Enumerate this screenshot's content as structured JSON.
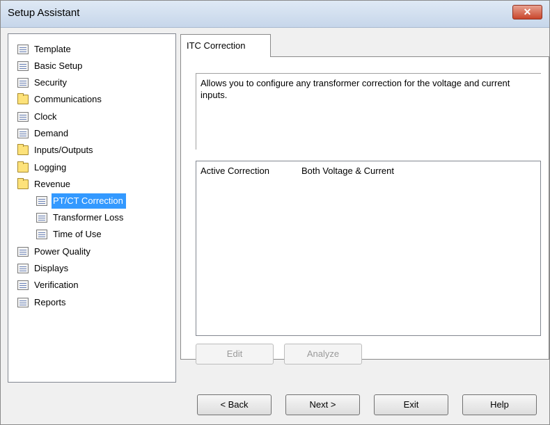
{
  "window": {
    "title": "Setup Assistant",
    "close_label": "✕"
  },
  "tree": {
    "items": [
      {
        "label": "Template",
        "icon": "document-icon"
      },
      {
        "label": "Basic Setup",
        "icon": "document-icon"
      },
      {
        "label": "Security",
        "icon": "document-icon"
      },
      {
        "label": "Communications",
        "icon": "folder-icon"
      },
      {
        "label": "Clock",
        "icon": "document-icon"
      },
      {
        "label": "Demand",
        "icon": "document-icon"
      },
      {
        "label": "Inputs/Outputs",
        "icon": "folder-icon"
      },
      {
        "label": "Logging",
        "icon": "folder-icon"
      },
      {
        "label": "Revenue",
        "icon": "folder-icon"
      },
      {
        "label": "PT/CT Correction",
        "icon": "document-icon",
        "selected": true
      },
      {
        "label": "Transformer Loss",
        "icon": "document-icon"
      },
      {
        "label": "Time of Use",
        "icon": "document-icon"
      },
      {
        "label": "Power Quality",
        "icon": "document-icon"
      },
      {
        "label": "Displays",
        "icon": "document-icon"
      },
      {
        "label": "Verification",
        "icon": "document-icon"
      },
      {
        "label": "Reports",
        "icon": "document-icon"
      }
    ]
  },
  "tab": {
    "label": "ITC Correction"
  },
  "description": "Allows you to configure any transformer correction for the voltage and current inputs.",
  "list": {
    "label": "Active Correction",
    "value": "Both Voltage & Current"
  },
  "panel_buttons": {
    "edit": "Edit",
    "analyze": "Analyze"
  },
  "footer_buttons": {
    "back": "< Back",
    "next": "Next >",
    "exit": "Exit",
    "help": "Help"
  },
  "colors": {
    "selection": "#3399ff",
    "folder": "#fde27a"
  }
}
